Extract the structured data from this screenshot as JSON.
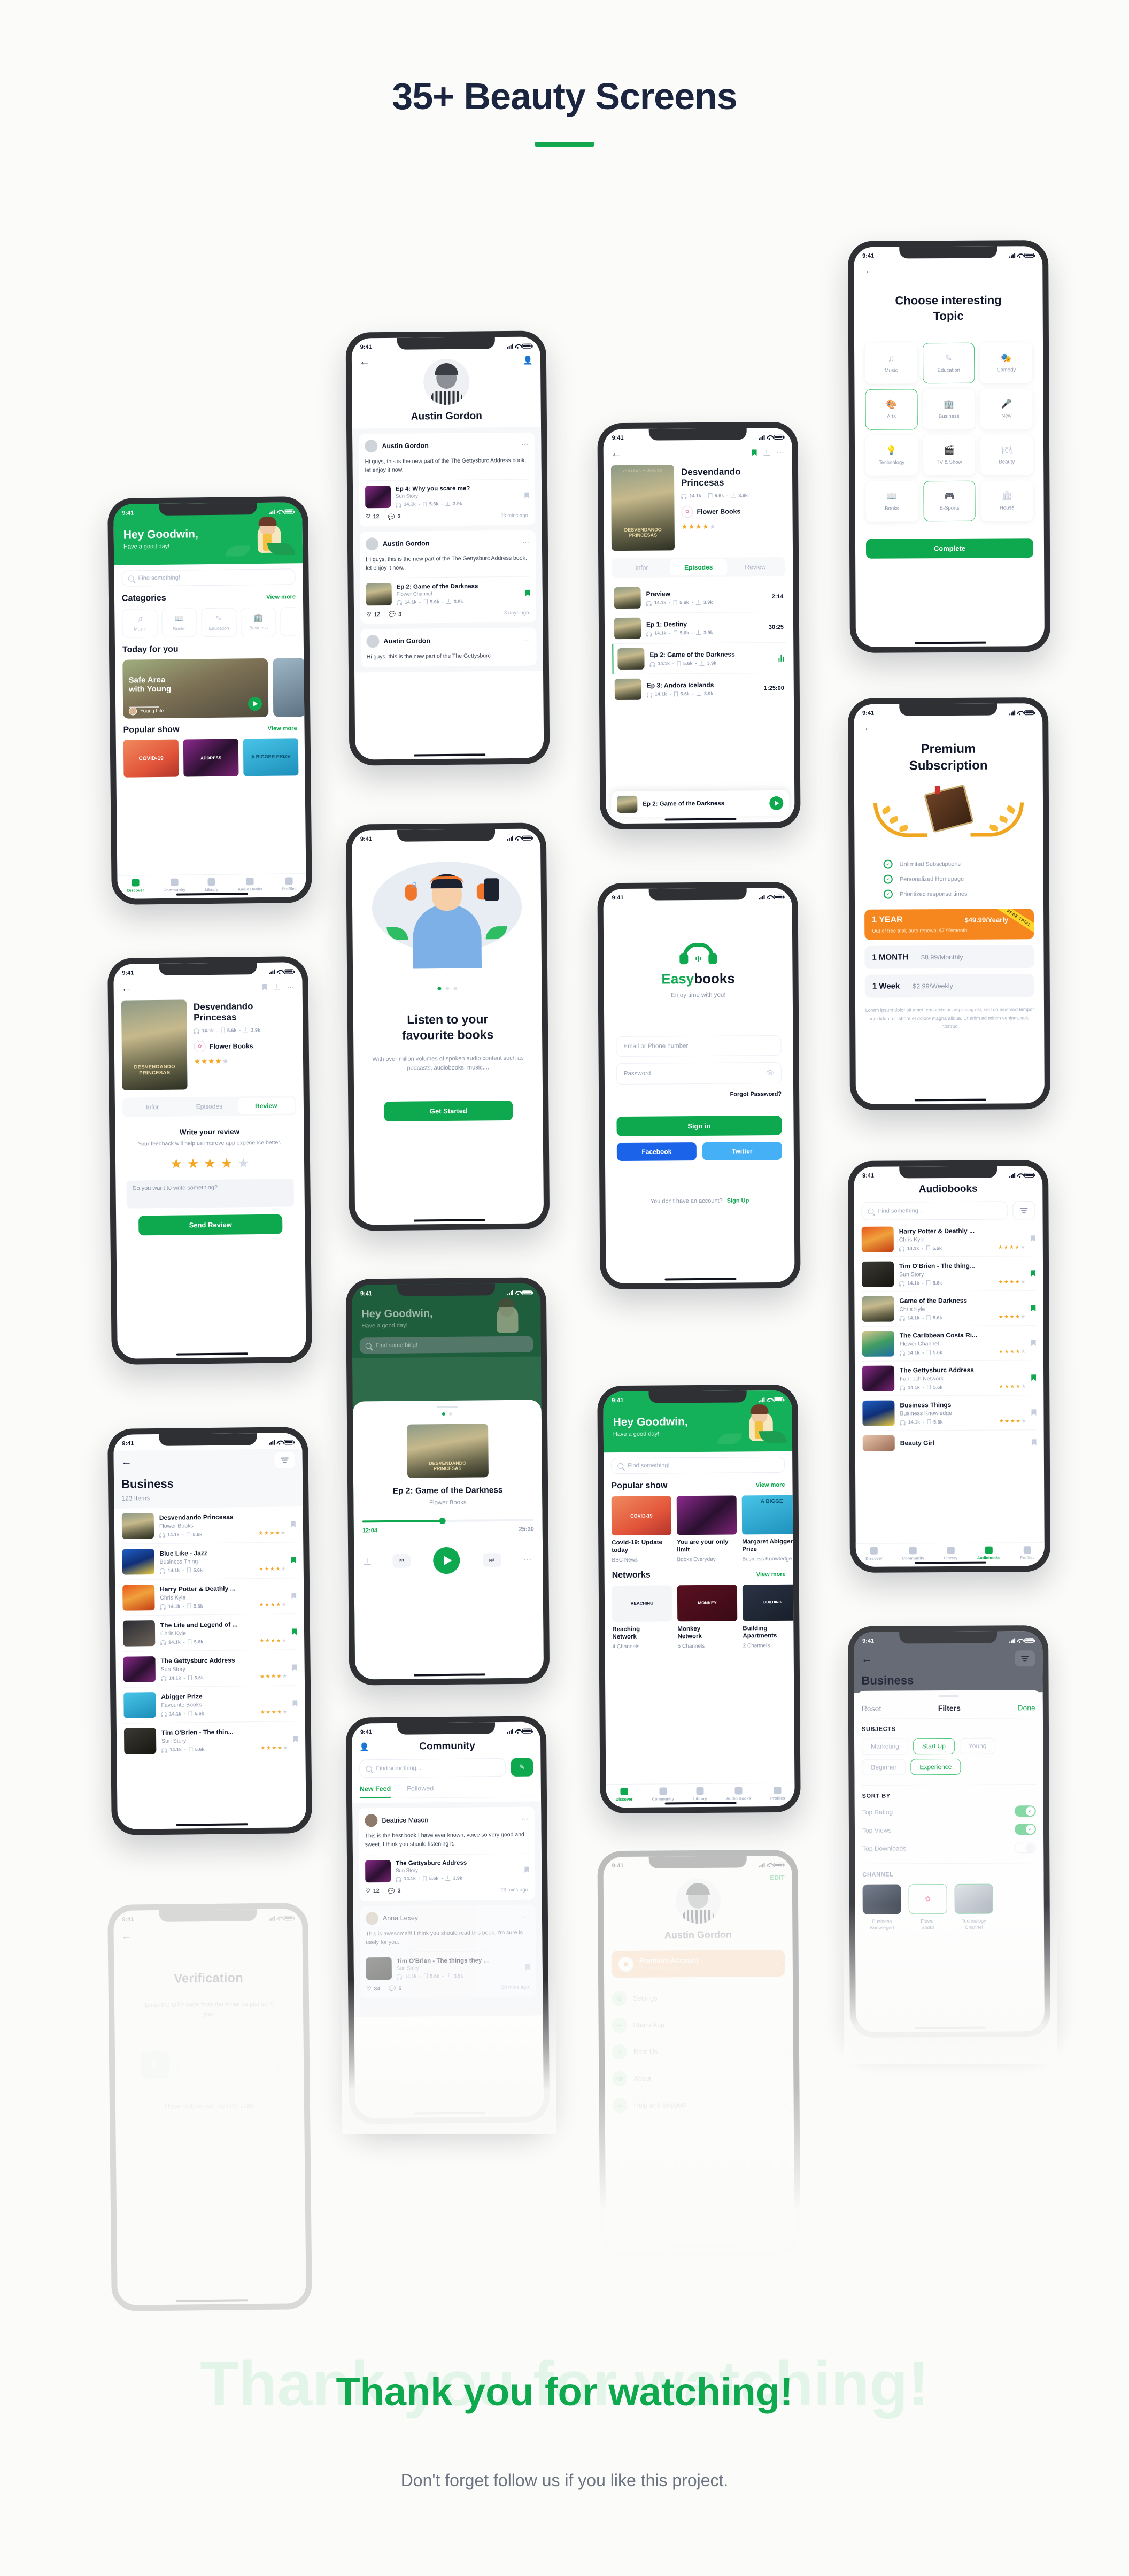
{
  "header": {
    "title": "35+ Beauty Screens"
  },
  "footer": {
    "ghost": "Thank you for watching!",
    "headline": "Thank you for watching!",
    "subtitle": "Don't forget follow us if you like this project."
  },
  "common": {
    "status_time": "9:41",
    "listens": "14.1k",
    "comments": "5.6k",
    "downloads": "3.9k",
    "search_placeholder_bang": "Find something!",
    "search_placeholder_dots": "Find something...",
    "view_more": "View more",
    "tabs": [
      {
        "label": "Discover",
        "icon": "compass-icon"
      },
      {
        "label": "Community",
        "icon": "people-icon"
      },
      {
        "label": "Library",
        "icon": "layers-icon"
      },
      {
        "label": "Audio Books",
        "icon": "audiobook-icon"
      },
      {
        "label": "Profiles",
        "icon": "person-icon"
      }
    ]
  },
  "screens": {
    "home": {
      "greeting": "Hey Goodwin,",
      "subgreeting": "Have a good day!",
      "categories_title": "Categories",
      "categories": [
        {
          "label": "Music",
          "icon": "music-note-icon"
        },
        {
          "label": "Books",
          "icon": "open-book-icon"
        },
        {
          "label": "Education",
          "icon": "pencil-cup-icon"
        },
        {
          "label": "Business",
          "icon": "buildings-icon"
        }
      ],
      "today_title": "Today for you",
      "feature": {
        "title_line1": "Safe Area",
        "title_line2": "with Young",
        "channel": "Young Life"
      },
      "popular_title": "Popular show",
      "popular": [
        {
          "title": "COVID-19"
        },
        {
          "title": "ADDRESS"
        },
        {
          "title": "A BIGGER PRIZE"
        }
      ]
    },
    "networks_home": {
      "greeting": "Hey Goodwin,",
      "subgreeting": "Have a good day!",
      "popular_title": "Popular show",
      "popular": [
        {
          "title": "Covid-19: Update today",
          "channel": "BBC News",
          "cover": "cv-covid"
        },
        {
          "title": "You are your only limit",
          "channel": "Books Everyday",
          "cover": "cv-getty"
        },
        {
          "title": "Margaret Abigger Prize",
          "channel": "Business Knowledge",
          "cover": "cv-prize"
        }
      ],
      "networks_title": "Networks",
      "networks": [
        {
          "name_line1": "Reaching",
          "name_line2": "Network",
          "channels": "4 Channels",
          "logo": "REACHING",
          "cover": "cv-reach"
        },
        {
          "name_line1": "Monkey",
          "name_line2": "Network",
          "channels": "5 Channels",
          "logo": "MONKEY",
          "cover": "cv-monkey"
        },
        {
          "name_line1": "Building",
          "name_line2": "Apartments",
          "channels": "2 Channels",
          "logo": "BUILDING",
          "cover": "cv-build"
        }
      ]
    },
    "topics": {
      "title_line1": "Choose interesting",
      "title_line2": "Topic",
      "items": [
        {
          "label": "Music",
          "icon": "music-note-icon",
          "selected": false
        },
        {
          "label": "Education",
          "icon": "pencil-cup-icon",
          "selected": true
        },
        {
          "label": "Comedy",
          "icon": "masks-icon",
          "selected": false
        },
        {
          "label": "Arts",
          "icon": "palette-icon",
          "selected": true
        },
        {
          "label": "Business",
          "icon": "buildings-icon",
          "selected": false
        },
        {
          "label": "New",
          "icon": "microphone-icon",
          "selected": false
        },
        {
          "label": "Technology",
          "icon": "lightbulb-icon",
          "selected": false
        },
        {
          "label": "TV & Show",
          "icon": "screen-icon",
          "selected": false
        },
        {
          "label": "Beauty",
          "icon": "plate-icon",
          "selected": false
        },
        {
          "label": "Books",
          "icon": "open-book-icon",
          "selected": false
        },
        {
          "label": "E-Sports",
          "icon": "gamepad-icon",
          "selected": true
        },
        {
          "label": "House",
          "icon": "curtain-icon",
          "selected": false
        }
      ],
      "complete_label": "Complete"
    },
    "premium": {
      "title_line1": "Premium",
      "title_line2": "Subscription",
      "benefits": [
        "Unlimited Subsctiptions",
        "Personalized Homepage",
        "Prioritized response times"
      ],
      "plans": [
        {
          "period": "1 YEAR",
          "price": "$49.99/Yearly",
          "note": "Out of free trial, auto renewal $7.99/month.",
          "ribbon": "FREE TRIAL",
          "featured": true
        },
        {
          "period": "1 MONTH",
          "price": "$8.99/Monthly",
          "featured": false
        },
        {
          "period": "1 Week",
          "price": "$2.99/Weekly",
          "featured": false
        }
      ],
      "legal": "Lorem ipsum dolor sit amet, consectetur adipiscing elit, sed do eiusmod tempor incididunt ut labore et dolore magna aliqua. Ut enim ad minim veniam, quis nostrud"
    },
    "audiobooks": {
      "title": "Audiobooks",
      "items": [
        {
          "title": "Harry Potter & Deathly ...",
          "channel": "Chris Kyle",
          "saved": false,
          "cover": "cv-hp"
        },
        {
          "title": "Tim O'Brien - The thing...",
          "channel": "Sun Story",
          "saved": true,
          "cover": "cv-tim"
        },
        {
          "title": "Game of the Darkness",
          "channel": "Chris Kyle",
          "saved": true,
          "cover": "cv-princ"
        },
        {
          "title": "The Caribbean Costa Ri...",
          "channel": "Flower Channel",
          "saved": false,
          "cover": "cv-carib"
        },
        {
          "title": "The Gettysburc Address",
          "channel": "FanTech Network",
          "saved": true,
          "cover": "cv-getty"
        },
        {
          "title": "Business Things",
          "channel": "Business Knowledge",
          "saved": false,
          "cover": "cv-blue"
        },
        {
          "title": "Beauty Girl",
          "channel": "",
          "saved": false,
          "cover": "cv-beauty"
        }
      ]
    },
    "business": {
      "title": "Business",
      "count": "123 Items",
      "items": [
        {
          "title": "Desvendando Princesas",
          "channel": "Flower Books",
          "saved": false,
          "cover": "cv-princ"
        },
        {
          "title": "Blue Like - Jazz",
          "channel": "Business Thing",
          "saved": true,
          "cover": "cv-blue"
        },
        {
          "title": "Harry Potter & Deathly ...",
          "channel": "Chris Kyle",
          "saved": false,
          "cover": "cv-hp"
        },
        {
          "title": "The Life and Legend of ...",
          "channel": "Chris Kyle",
          "saved": true,
          "cover": "cv-chris"
        },
        {
          "title": "The Gettysburc Address",
          "channel": "Sun Story",
          "saved": false,
          "cover": "cv-getty"
        },
        {
          "title": "Abigger Prize",
          "channel": "Favourite Books",
          "saved": false,
          "cover": "cv-prize"
        },
        {
          "title": "Tim O'Brien - The thin...",
          "channel": "Sun Story",
          "saved": false,
          "cover": "cv-tim"
        }
      ]
    },
    "filters": {
      "behind_title": "Business",
      "reset_label": "Reset",
      "title": "Filters",
      "done_label": "Done",
      "subjects_label": "SUBJECTS",
      "subjects": [
        {
          "label": "Marketing",
          "selected": false
        },
        {
          "label": "Start Up",
          "selected": true
        },
        {
          "label": "Young",
          "selected": false
        },
        {
          "label": "Beginner",
          "selected": false
        },
        {
          "label": "Experience",
          "selected": true
        }
      ],
      "sort_label": "SORT BY",
      "sorts": [
        {
          "label": "Top Rating",
          "on": true
        },
        {
          "label": "Top Views",
          "on": true
        },
        {
          "label": "Top Downloads",
          "on": false
        }
      ],
      "channel_label": "CHANNEL",
      "channels": [
        {
          "name_line1": "Business",
          "name_line2": "Knowleged",
          "selected": false,
          "cover": "cv-bbiz"
        },
        {
          "name_line1": "Flower",
          "name_line2": "Books",
          "selected": true,
          "cover": "cv-flower"
        },
        {
          "name_line1": "Technology",
          "name_line2": "Channel",
          "selected": true,
          "cover": "cv-tech"
        }
      ]
    },
    "book_episodes": {
      "title_line1": "Desvendando",
      "title_line2": "Princesas",
      "channel": "Flower Books",
      "tabs": [
        {
          "label": "Infor",
          "active": false
        },
        {
          "label": "Episodes",
          "active": true
        },
        {
          "label": "Review",
          "active": false
        }
      ],
      "episodes": [
        {
          "title": "Preview",
          "duration": "2:14",
          "playing": false
        },
        {
          "title": "Ep 1: Destiny",
          "duration": "30:25",
          "playing": false
        },
        {
          "title": "Ep 2: Game of the Darkness",
          "duration": "",
          "playing": true
        },
        {
          "title": "Ep 3: Andora Icelands",
          "duration": "1:25:00",
          "playing": false
        }
      ],
      "miniplayer": {
        "title": "Ep 2: Game of the Darkness"
      }
    },
    "book_review": {
      "title_line1": "Desvendando",
      "title_line2": "Princesas",
      "channel": "Flower Books",
      "tabs": [
        {
          "label": "Infor",
          "active": false
        },
        {
          "label": "Episodes",
          "active": false
        },
        {
          "label": "Review",
          "active": true
        }
      ],
      "review_title": "Write your review",
      "review_sub": "Your feedback will help us improve app experience better.",
      "rating": 4,
      "input_placeholder": "Do you want to write something?",
      "send_label": "Send Review"
    },
    "profile_feed": {
      "name": "Austin Gordon",
      "posts": [
        {
          "author": "Austin Gordon",
          "text": "Hi guys, this is the new part of the The Gettysburc Address book, let enjoy it now.",
          "item_title": "Ep 4: Why you scare me?",
          "item_channel": "Sun Story",
          "saved": false,
          "cover": "cv-getty",
          "likes": "12",
          "comments": "3",
          "time": "23 mins ago."
        },
        {
          "author": "Austin Gordon",
          "text": "Hi guys, this is the new part of the The Gettysburc Address book, let enjoy it now.",
          "item_title": "Ep 2: Game of the Darkness",
          "item_channel": "Flower Channel",
          "saved": true,
          "cover": "cv-princ",
          "likes": "12",
          "comments": "3",
          "time": "3 days ago."
        },
        {
          "author": "Austin Gordon",
          "text": "Hi guys, this is the new part of the The Gettysburc",
          "item_title": "",
          "item_channel": "",
          "saved": false,
          "cover": "cv-princ",
          "likes": "",
          "comments": "",
          "time": ""
        }
      ]
    },
    "signin": {
      "brand_a": "Easy",
      "brand_b": "books",
      "tagline": "Enjoy time with you!",
      "email_placeholder": "Email or Phone number",
      "password_placeholder": "Password",
      "forgot_label": "Forgot Password?",
      "signin_label": "Sign in",
      "facebook_label": "Facebook",
      "twitter_label": "Twitter",
      "no_account": "You don't have an account?",
      "signup_label": "Sign Up"
    },
    "onboarding": {
      "title_line1": "Listen to your",
      "title_line2": "favourite books",
      "subtitle": "With over milion volumes of spoken audio content such as podcasts, audiobooks, music,...",
      "cta_label": "Get Started",
      "dots": 3,
      "active_dot": 0
    },
    "player": {
      "greeting": "Hey Goodwin,",
      "subgreeting": "Have a good day!",
      "search_placeholder": "Find something!",
      "title": "Ep 2: Game of the Darkness",
      "channel": "Flower Books",
      "elapsed": "12:04",
      "total": "25:30",
      "progress_pct": 45
    },
    "community": {
      "title": "Community",
      "search_placeholder": "Find something...",
      "tabs": [
        {
          "label": "New Feed",
          "active": true
        },
        {
          "label": "Followed",
          "active": false
        }
      ],
      "posts": [
        {
          "author": "Beatrice Mason",
          "text": "This is the best book I have ever known, voice so very good and sweet. I think you should listening it.",
          "item_title": "The Gettysburc Address",
          "item_channel": "Sun Story",
          "cover": "cv-getty",
          "likes": "12",
          "comments": "3",
          "time": "23 mins ago."
        },
        {
          "author": "Anna Lexey",
          "text": "This is awesome!!! I think you should read this book. I'm sure is usely for you.",
          "item_title": "Tim O'Brien - The things they ...",
          "item_channel": "Sun Story",
          "cover": "cv-tim",
          "likes": "34",
          "comments": "5",
          "time": "50 mins ago."
        }
      ]
    },
    "profile_menu": {
      "edit_label": "EDIT",
      "name": "Austin Gordon",
      "premium_title": "Premium Account",
      "premium_sub": "Premium Account",
      "items": [
        {
          "label": "Settings",
          "icon": "gear-icon"
        },
        {
          "label": "Share App",
          "icon": "share-icon"
        },
        {
          "label": "Rate Us",
          "icon": "star-icon"
        },
        {
          "label": "About",
          "icon": "eye-icon"
        },
        {
          "label": "Help and Support",
          "icon": "help-icon"
        }
      ]
    },
    "verification": {
      "title": "Verification",
      "subtitle": "Enter the OTP code from the email us just sent you.",
      "code_digits": [
        "6",
        "",
        "",
        ""
      ],
      "problem_label": "I have problem with my OTP code."
    }
  },
  "colors": {
    "brand_green": "#0ea84e",
    "navy": "#12182b",
    "orange": "#f5a623",
    "facebook": "#1b63e8",
    "twitter": "#45b0f5"
  }
}
